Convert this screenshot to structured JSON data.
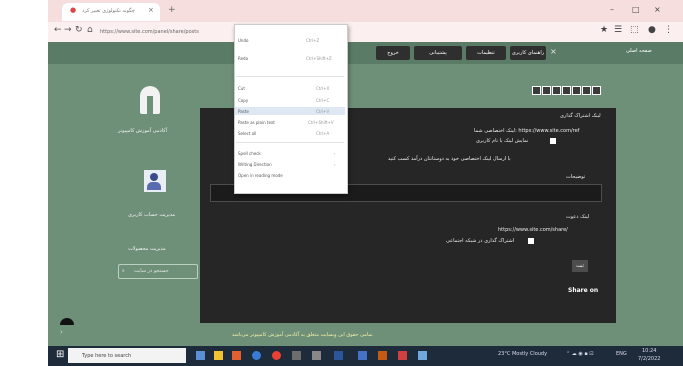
{
  "browser": {
    "tab_title": "چگونه تکنولوژی تغییر کرد",
    "tab_close": "×",
    "new_tab": "+",
    "window_controls": [
      "–",
      "□",
      "×"
    ],
    "nav": [
      "←",
      "→",
      "↻",
      "⌂"
    ],
    "url": "https://www.site.com/panel/share/posts",
    "toolbar_icons": [
      "★",
      "☰",
      "⬚",
      "●",
      "⋮"
    ]
  },
  "context_menu": {
    "items": [
      {
        "label": "Undo",
        "shortcut": "Ctrl+Z"
      },
      {
        "label": "Redo",
        "shortcut": "Ctrl+Shift+Z"
      },
      {
        "label": "Cut",
        "shortcut": "Ctrl+X"
      },
      {
        "label": "Copy",
        "shortcut": "Ctrl+C"
      },
      {
        "label": "Paste",
        "shortcut": "Ctrl+V"
      },
      {
        "label": "Paste as plain text",
        "shortcut": "Ctrl+Shift+V"
      },
      {
        "label": "Select all",
        "shortcut": "Ctrl+A"
      },
      {
        "label": "Spell check",
        "shortcut": "›"
      },
      {
        "label": "Writing Direction",
        "shortcut": "›"
      },
      {
        "label": "Open in reading mode",
        "shortcut": ""
      }
    ],
    "highlighted_index": 4
  },
  "navbar": {
    "brand": "صفحه اصلی",
    "close": "×",
    "buttons": [
      "راهنمای کاربری",
      "تنظیمات",
      "پشتیبانی",
      "خروج"
    ]
  },
  "sidebar": {
    "site_name": "آکادمی آموزش کامپیوتر",
    "user_name": "مدیریت حساب کاربری",
    "section_label": "مدیریت محصولات",
    "search_placeholder": "جستجو در سایت"
  },
  "panel": {
    "heading": "لینک اشتراک گذاری",
    "intro_line": "لینک اختصاصی شما: https://www.site.com/ref",
    "checkbox_label": "نمایش لینک با نام کاربری",
    "description": "با ارسال لینک اختصاصی خود به دوستانتان درآمد کسب کنید",
    "field_label": "توضیحات",
    "field_value": "",
    "share_link_label": "لینک دعوت",
    "share_link": "https://www.site.com/share/",
    "checkbox2_label": "اشتراک گذاری در شبکه اجتماعی",
    "add_button": "ثبت",
    "share_text": "Share on"
  },
  "footer": {
    "text": "تمامی حقوق این وبسایت متعلق به آکادمی آموزش کامپیوتر می‌باشد"
  },
  "taskbar": {
    "start": "⊞",
    "search_placeholder": "Type here to search",
    "tray_weather": "23°C  Mostly Cloudy",
    "tray_lang": "ENG",
    "time": "10:24",
    "date": "7/2/2022"
  },
  "colors": {
    "page_green": "#6e8f78",
    "panel_dark": "#262626",
    "taskbar": "#1d2b3a"
  }
}
